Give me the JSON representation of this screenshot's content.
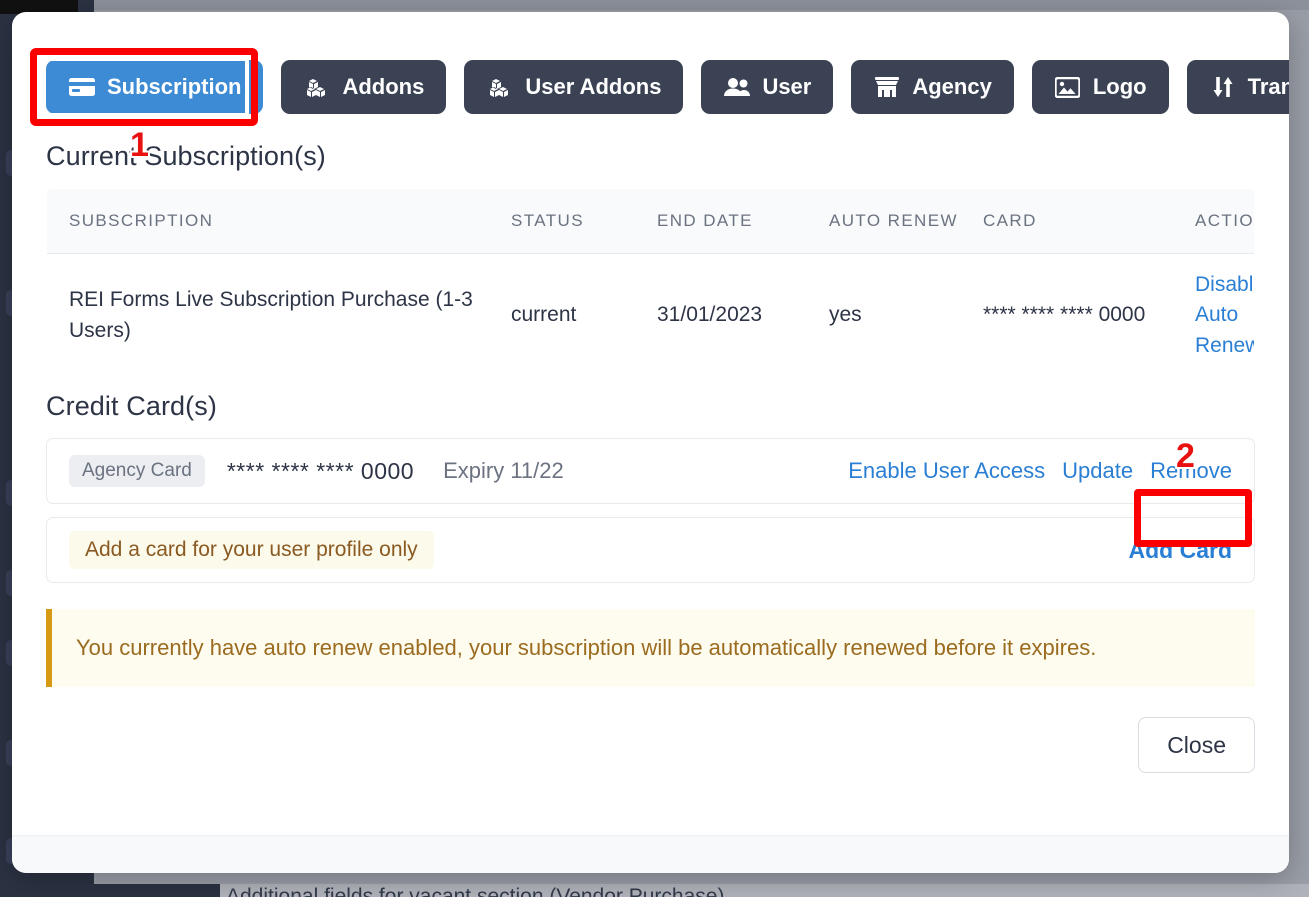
{
  "background": {
    "cut_off_text": "Additional fields for vacant section (Vendor Purchase)"
  },
  "modal": {
    "tabs": [
      {
        "label": "Subscription",
        "icon": "credit-card-icon",
        "active": true
      },
      {
        "label": "Addons",
        "icon": "cubes-icon",
        "active": false
      },
      {
        "label": "User Addons",
        "icon": "cubes-icon",
        "active": false
      },
      {
        "label": "User",
        "icon": "users-icon",
        "active": false
      },
      {
        "label": "Agency",
        "icon": "store-icon",
        "active": false
      },
      {
        "label": "Logo",
        "icon": "image-icon",
        "active": false
      },
      {
        "label": "Transactions",
        "icon": "sort-arrows-icon",
        "active": false
      }
    ],
    "subscription_section": {
      "title": "Current Subscription(s)",
      "columns": [
        "SUBSCRIPTION",
        "STATUS",
        "END DATE",
        "AUTO RENEW",
        "CARD",
        "ACTIONS"
      ],
      "rows": [
        {
          "subscription": "REI Forms Live Subscription Purchase (1-3 Users)",
          "status": "current",
          "end_date": "31/01/2023",
          "auto_renew": "yes",
          "card": "**** **** **** 0000",
          "action": "Disable Auto Renew"
        }
      ]
    },
    "credit_card_section": {
      "title": "Credit Card(s)",
      "cards": [
        {
          "badge": "Agency Card",
          "number": "**** **** **** 0000",
          "expiry": "Expiry 11/22",
          "actions": [
            "Enable User Access",
            "Update",
            "Remove"
          ]
        }
      ],
      "add_card_row": {
        "note": "Add a card for your user profile only",
        "action": "Add Card"
      }
    },
    "alert": {
      "message": "You currently have auto renew enabled, your subscription will be automatically renewed before it expires."
    },
    "footer": {
      "close_label": "Close"
    }
  },
  "annotations": {
    "markers": [
      {
        "number": "1",
        "target": "Subscription tab"
      },
      {
        "number": "2",
        "target": "Remove link"
      }
    ]
  },
  "colors": {
    "accent_blue": "#3d8bd4",
    "tab_dark": "#3a4254",
    "link_blue": "#2a7fd4",
    "alert_bg": "#fdfcee",
    "alert_border": "#d79a14",
    "highlight_red": "#fc0000"
  }
}
